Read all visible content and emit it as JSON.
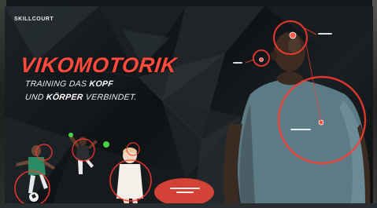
{
  "brand": {
    "name": "SKILLCOURT"
  },
  "headline": {
    "title": "VIKOMOTORIK"
  },
  "tagline": {
    "line1_normal": "TRAINING DAS ",
    "line1_bold": "KOPF",
    "line2_normal": "UND ",
    "line2_bold": "KÖRPER",
    "line2_end": " VERBINDET."
  },
  "colors": {
    "accent": "#ff4a3d",
    "text": "#ffffff",
    "background": "#111416"
  }
}
